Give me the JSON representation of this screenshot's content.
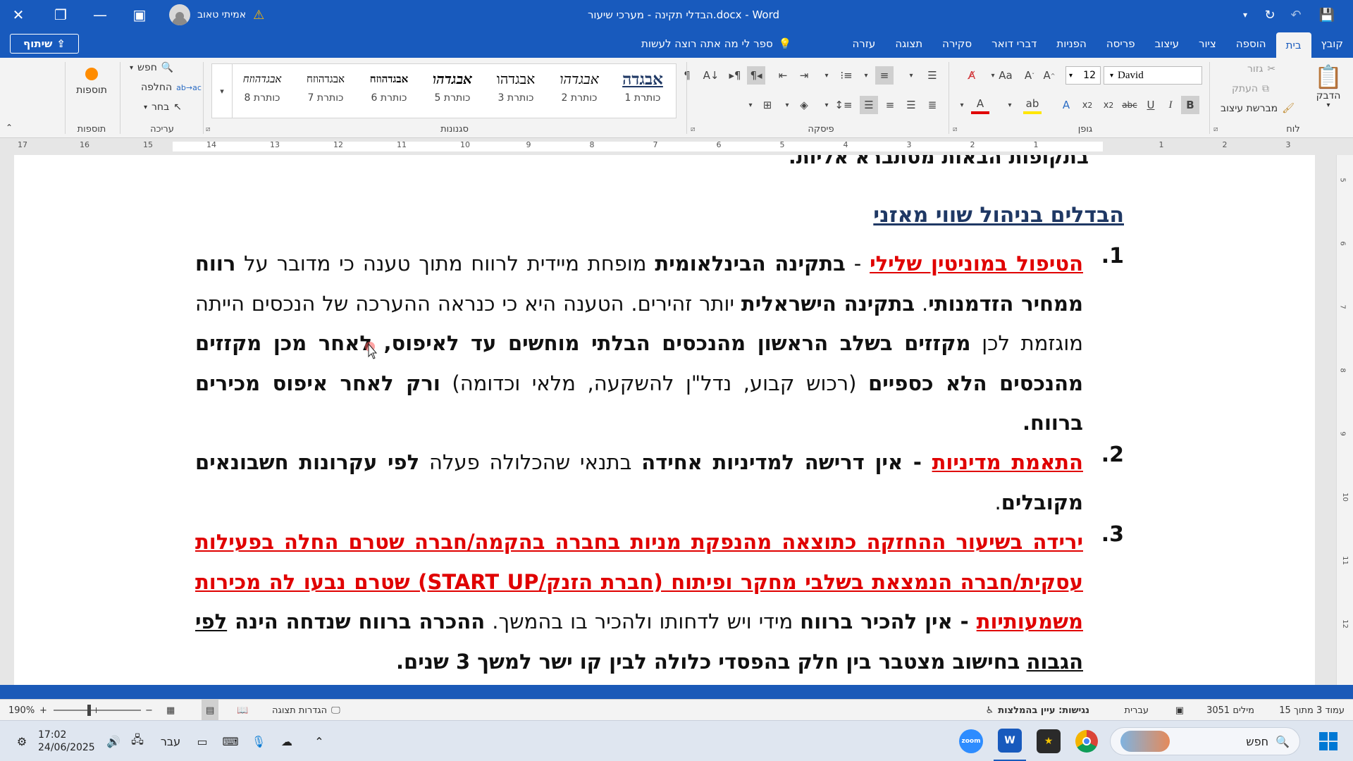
{
  "titlebar": {
    "document_title": "הבדלי תקינה - מערכי שיעור.docx - Word",
    "user_name": "אמיתי טאוב"
  },
  "ribbon": {
    "tabs": [
      "קובץ",
      "בית",
      "הוספה",
      "ציור",
      "עיצוב",
      "פריסה",
      "הפניות",
      "דברי דואר",
      "סקירה",
      "תצוגה",
      "עזרה"
    ],
    "active_tab": "בית",
    "tell_me": "ספר לי מה אתה רוצה לעשות",
    "share_label": "שיתוף",
    "clipboard": {
      "paste": "הדבק",
      "cut": "גזור",
      "copy": "העתק",
      "format_painter": "מברשת עיצוב",
      "group_label": "לוח"
    },
    "font": {
      "name": "David",
      "size": "12",
      "group_label": "גופן"
    },
    "paragraph": {
      "group_label": "פיסקה"
    },
    "styles": {
      "group_label": "סגנונות",
      "items": [
        {
          "sample": "אבגדה",
          "label": "כותרת 1"
        },
        {
          "sample": "אבגדהו",
          "label": "כותרת 2"
        },
        {
          "sample": "אבגדהו",
          "label": "כותרת 3"
        },
        {
          "sample": "אבגדהו",
          "label": "כותרת 5"
        },
        {
          "sample": "אבגדהוזח",
          "label": "כותרת 6"
        },
        {
          "sample": "אבגדהוזח",
          "label": "כותרת 7"
        },
        {
          "sample": "אבגדהוזח",
          "label": "כותרת 8"
        }
      ]
    },
    "editing": {
      "find": "חפש",
      "replace": "החלפה",
      "select": "בחר",
      "group_label": "עריכה"
    },
    "addins": {
      "button": "תוספות",
      "group_label": "תוספות"
    }
  },
  "ruler": {
    "numbers": [
      "3",
      "2",
      "1",
      "1",
      "2",
      "3",
      "4",
      "5",
      "6",
      "7",
      "8",
      "9",
      "10",
      "11",
      "12",
      "13",
      "14",
      "15",
      "16",
      "17"
    ]
  },
  "document": {
    "cut_line": "בתקופות הבאות מסתברא אליות.",
    "heading": "הבדלים בניהול שווי מאזני",
    "items": [
      {
        "num": "1.",
        "parts": [
          {
            "t": "הטיפול במוניטין שלילי",
            "s": "red-u"
          },
          {
            "t": " - ",
            "s": ""
          },
          {
            "t": "בתקינה הבינלאומית",
            "s": "b"
          },
          {
            "t": " מופחת מיידית לרווח מתוך טענה כי מדובר על ",
            "s": ""
          },
          {
            "t": "רווח ממחיר הזדמנותי",
            "s": "b"
          },
          {
            "t": ". ",
            "s": ""
          },
          {
            "t": "בתקינה הישראלית",
            "s": "b"
          },
          {
            "t": " יותר זהירים. הטענה היא כי כנראה ההערכה של הנכסים הייתה מוגזמת לכן ",
            "s": ""
          },
          {
            "t": "מקזזים בשלב הראשון מהנכסים הבלתי מוחשים עד לאיפוס, לאחר מכן מקזזים מהנכסים הלא כספיים",
            "s": "b"
          },
          {
            "t": " (רכוש קבוע, נדל\"ן להשקעה, מלאי וכדומה) ",
            "s": ""
          },
          {
            "t": "ורק לאחר איפוס מכירים ברווח.",
            "s": "b"
          }
        ]
      },
      {
        "num": "2.",
        "parts": [
          {
            "t": "התאמת מדיניות",
            "s": "red-u"
          },
          {
            "t": " - ",
            "s": "b"
          },
          {
            "t": "אין דרישה למדיניות אחידה",
            "s": "b"
          },
          {
            "t": " בתנאי שהכלולה פעלה ",
            "s": ""
          },
          {
            "t": "לפי עקרונות חשבונאים מקובלים",
            "s": "b"
          },
          {
            "t": ".",
            "s": ""
          }
        ]
      },
      {
        "num": "3.",
        "parts": [
          {
            "t": "ירידה בשיעור ההחזקה כתוצאה מהנפקת מניות בחברה בהקמה/חברה שטרם החלה בפעילות עסקית/חברה הנמצאת בשלבי מחקר ופיתוח (חברת הזנק/START UP) שטרם נבעו לה מכירות משמעותיות",
            "s": "red-u"
          },
          {
            "t": " - ",
            "s": "b"
          },
          {
            "t": "אין להכיר ברווח",
            "s": "b"
          },
          {
            "t": " מידי ויש לדחותו ולהכיר בו בהמשך. ",
            "s": ""
          },
          {
            "t": "ההכרה ברווח שנדחה הינה ",
            "s": "b"
          },
          {
            "t": "לפי הגבוה",
            "s": "b u"
          },
          {
            "t": " ",
            "s": ""
          },
          {
            "t": "בחישוב מצטבר בין חלק בהפסדי כלולה לבין קו ישר למשך 3 שנים.",
            "s": "b"
          }
        ]
      }
    ]
  },
  "statusbar": {
    "page": "עמוד 3 מתוך 15",
    "words": "3051 מילים",
    "language": "עברית",
    "accessibility": "נגישות: עיין בהמלצות",
    "display_settings": "הגדרות תצוגה",
    "zoom": "190%"
  },
  "taskbar": {
    "search": "חפש",
    "time": "17:02",
    "date": "24/06/2025",
    "lang": "עבר"
  },
  "colors": {
    "word_blue": "#185abd",
    "heading_blue": "#1f3864",
    "red": "#e00000"
  }
}
